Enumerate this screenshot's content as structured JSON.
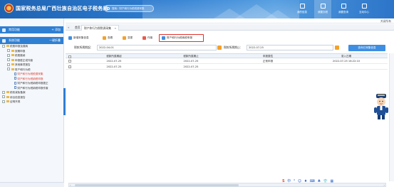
{
  "header": {
    "title": "国家税务总局广西壮族自治区电子税务局",
    "search_placeholder": "搜索：财产和行为税税源采集",
    "nav": [
      {
        "label": "我的信息",
        "icon": "user-icon"
      },
      {
        "label": "我要办税",
        "icon": "tax-icon"
      },
      {
        "label": "我要查询",
        "icon": "query-icon"
      },
      {
        "label": "互动中心",
        "icon": "interact-icon"
      }
    ]
  },
  "sidebar": {
    "common_functions": {
      "label": "常用功能",
      "action": "+ 添加"
    },
    "system_functions": {
      "label": "系统功能",
      "action": "一键折叠"
    },
    "tree": [
      {
        "label": "税费申报及缴纳",
        "level": 0,
        "kind": "folder",
        "expanded": true
      },
      {
        "label": "按期申报",
        "level": 1,
        "kind": "folder"
      },
      {
        "label": "税费缴纳",
        "level": 1,
        "kind": "folder"
      },
      {
        "label": "申报更正或作废",
        "level": 1,
        "kind": "folder"
      },
      {
        "label": "其他事项报告",
        "level": 1,
        "kind": "folder"
      },
      {
        "label": "财产和行为税",
        "level": 1,
        "kind": "folder",
        "expanded": true
      },
      {
        "label": "财产和行为税税源采集",
        "level": 2,
        "kind": "doc",
        "active": true
      },
      {
        "label": "财产和行为税纳税申报",
        "level": 2,
        "kind": "doc",
        "active": true
      },
      {
        "label": "财产和行为税纳税申报更正",
        "level": 2,
        "kind": "doc"
      },
      {
        "label": "财产和行为税纳税申报作废",
        "level": 2,
        "kind": "doc"
      },
      {
        "label": "税收减免备案",
        "level": 0,
        "kind": "folder"
      },
      {
        "label": "综合信息报告",
        "level": 0,
        "kind": "folder"
      },
      {
        "label": "证明开具",
        "level": 0,
        "kind": "folder"
      }
    ]
  },
  "main": {
    "close_all": "关闭所有",
    "tabs": [
      {
        "label": "首页",
        "active": false
      },
      {
        "label": "财产和行为税税源采集",
        "active": true
      }
    ],
    "toolbar": [
      {
        "label": "新增采集信息",
        "color": "#3e8ee2"
      },
      {
        "label": "查看",
        "color": "#f3a12c"
      },
      {
        "label": "变更",
        "color": "#f3a12c"
      },
      {
        "label": "作废",
        "color": "#e85a4f"
      },
      {
        "label": "财产和行为税纳税申报",
        "color": "#3e8ee2"
      }
    ],
    "filter": {
      "start_label": "税款所属期起：",
      "start_value": "2022-04-01",
      "end_label": "税款所属期止：",
      "end_value": "2022-07-25",
      "query_button": "查询已采集信息"
    },
    "table": {
      "columns": [
        "税款所属期起",
        "税款所属期止",
        "申报属性",
        "录入日期"
      ],
      "rows": [
        [
          "2022-07-25",
          "2022-07-25",
          "正常申报",
          "2022-07-25 16:22:10"
        ],
        [
          "2022-07-25",
          "2022-07-25",
          "",
          ""
        ]
      ]
    }
  },
  "taskbar": {
    "ime_symbols": [
      "S",
      "中",
      "°",
      "☺",
      "♦",
      "⌨",
      "♣",
      "👕",
      "▦"
    ]
  },
  "colors": {
    "header_blue": "#2f7fd3",
    "highlight_red": "#e0312b",
    "link_red": "#e23b2e"
  }
}
